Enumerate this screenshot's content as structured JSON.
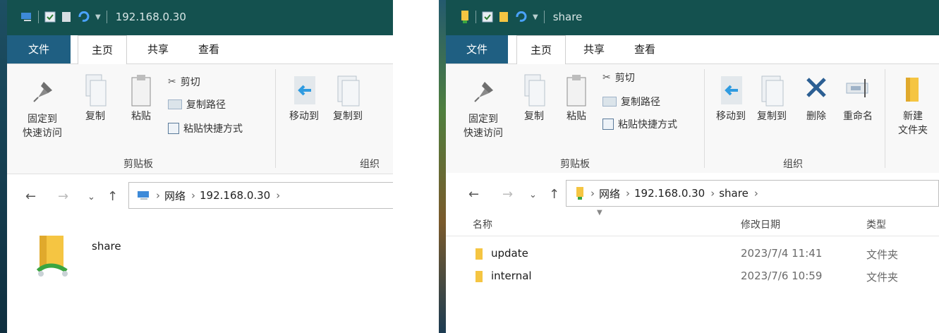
{
  "window1": {
    "title": "192.168.0.30",
    "tabs": [
      "文件",
      "主页",
      "共享",
      "查看"
    ],
    "ribbon": {
      "pin_label_line1": "固定到",
      "pin_label_line2": "快速访问",
      "copy": "复制",
      "paste": "粘贴",
      "cut": "剪切",
      "copy_path": "复制路径",
      "paste_shortcut": "粘贴快捷方式",
      "move_to": "移动到",
      "copy_to": "复制到",
      "clipboard_group": "剪贴板",
      "organize_group": "组织"
    },
    "breadcrumbs": [
      "网络",
      "192.168.0.30"
    ],
    "items": [
      {
        "name": "share"
      }
    ]
  },
  "window2": {
    "title": "share",
    "tabs": [
      "文件",
      "主页",
      "共享",
      "查看"
    ],
    "ribbon": {
      "pin_label_line1": "固定到",
      "pin_label_line2": "快速访问",
      "copy": "复制",
      "paste": "粘贴",
      "cut": "剪切",
      "copy_path": "复制路径",
      "paste_shortcut": "粘贴快捷方式",
      "move_to": "移动到",
      "copy_to": "复制到",
      "delete": "删除",
      "rename": "重命名",
      "new_folder_line1": "新建",
      "new_folder_line2": "文件夹",
      "clipboard_group": "剪贴板",
      "organize_group": "组织"
    },
    "breadcrumbs": [
      "网络",
      "192.168.0.30",
      "share"
    ],
    "columns": {
      "name": "名称",
      "date": "修改日期",
      "type": "类型"
    },
    "rows": [
      {
        "name": "update",
        "date": "2023/7/4 11:41",
        "type": "文件夹"
      },
      {
        "name": "internal",
        "date": "2023/7/6 10:59",
        "type": "文件夹"
      }
    ]
  },
  "colors": {
    "titlebar": "#14514f",
    "file_tab": "#1f5f82",
    "folder": "#f5c542"
  }
}
